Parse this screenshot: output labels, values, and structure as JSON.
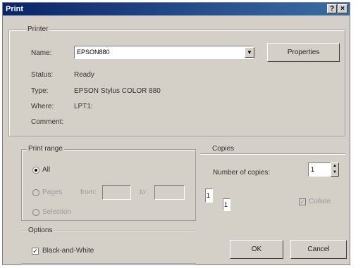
{
  "title": "Print",
  "titlebar": {
    "help_label": "?",
    "close_label": "×"
  },
  "printer": {
    "legend": "Printer",
    "name_label": "Name:",
    "name_value": "EPSON880",
    "properties_label": "Properties",
    "status_label": "Status:",
    "status_value": "Ready",
    "type_label": "Type:",
    "type_value": "EPSON Stylus COLOR 880",
    "where_label": "Where:",
    "where_value": "LPT1:",
    "comment_label": "Comment:"
  },
  "print_range": {
    "legend": "Print range",
    "all_label": "All",
    "pages_label": "Pages",
    "from_label": "from:",
    "to_label": "to:",
    "selection_label": "Selection"
  },
  "copies": {
    "legend": "Copies",
    "number_label": "Number of copies:",
    "number_value": "1",
    "collate_label": "Collate",
    "page_icon_1": "1",
    "page_icon_2": "1"
  },
  "options": {
    "legend": "Options",
    "bw_label": "Black-and-White",
    "bw_checked": true
  },
  "buttons": {
    "ok_label": "OK",
    "cancel_label": "Cancel"
  }
}
